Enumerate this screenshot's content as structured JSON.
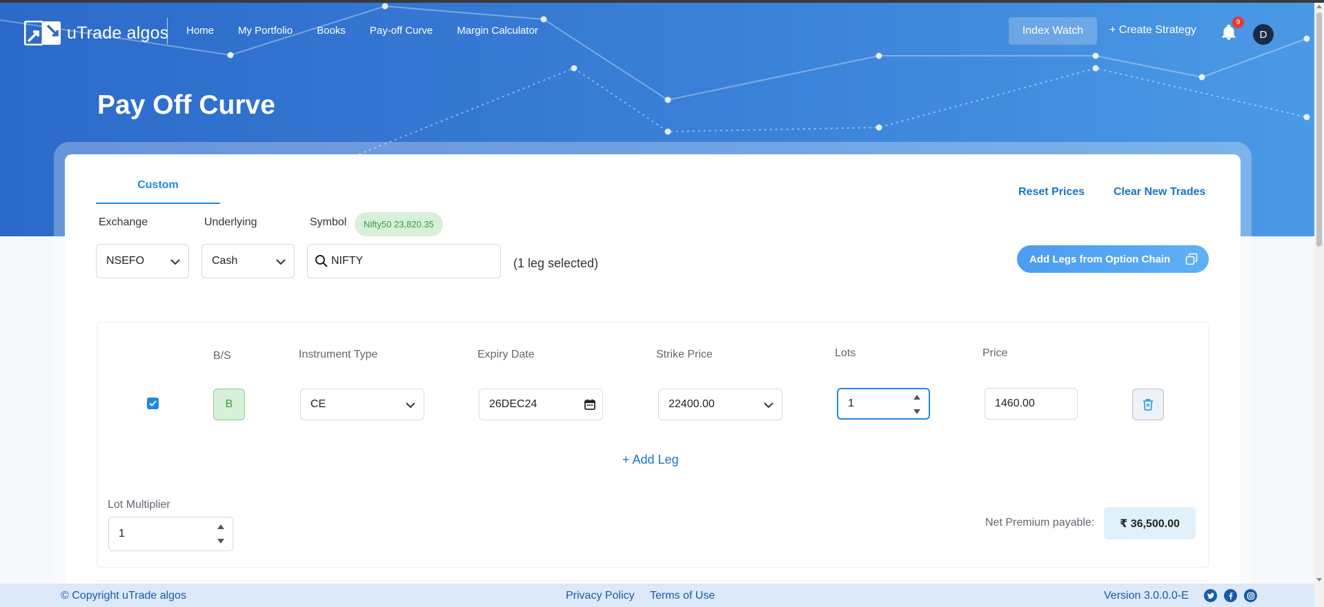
{
  "app": {
    "logo_text": "uTrade algos"
  },
  "nav": {
    "links": [
      "Home",
      "My Portfolio",
      "Books",
      "Pay-off Curve",
      "Margin Calculator"
    ],
    "index_watch": "Index Watch",
    "create_strategy": "+ Create Strategy",
    "notification_count": "9",
    "avatar_initial": "D"
  },
  "page": {
    "title": "Pay Off Curve"
  },
  "tabs": {
    "custom": "Custom"
  },
  "actions": {
    "reset_prices": "Reset Prices",
    "clear_new_trades": "Clear New Trades",
    "add_legs_from_option_chain": "Add Legs from Option Chain",
    "add_leg": "+ Add Leg"
  },
  "filters": {
    "exchange_label": "Exchange",
    "exchange_value": "NSEFO",
    "underlying_label": "Underlying",
    "underlying_value": "Cash",
    "symbol_label": "Symbol",
    "symbol_badge": "Nifty50 23,820.35",
    "search_value": "NIFTY",
    "legs_selected": "(1 leg selected)"
  },
  "legs_table": {
    "headers": {
      "bs": "B/S",
      "instrument_type": "Instrument Type",
      "expiry_date": "Expiry Date",
      "strike_price": "Strike Price",
      "lots": "Lots",
      "price": "Price"
    },
    "rows": [
      {
        "checked": true,
        "bs": "B",
        "instrument_type": "CE",
        "expiry_date": "26DEC24",
        "strike_price": "22400.00",
        "lots": "1",
        "price": "1460.00"
      }
    ]
  },
  "lot_multiplier": {
    "label": "Lot Multiplier",
    "value": "1"
  },
  "net_premium": {
    "label": "Net Premium payable:",
    "value": "₹ 36,500.00"
  },
  "footer": {
    "copyright": "© Copyright uTrade algos",
    "privacy_policy": "Privacy Policy",
    "terms_of_use": "Terms of Use",
    "version": "Version 3.0.0.0-E"
  },
  "colors": {
    "accent": "#1e88e5",
    "hero_start": "#2c6ac9",
    "hero_end": "#4b9ae6",
    "buy_green": "#3a9a44",
    "footer_bg": "#dbe9f8"
  }
}
